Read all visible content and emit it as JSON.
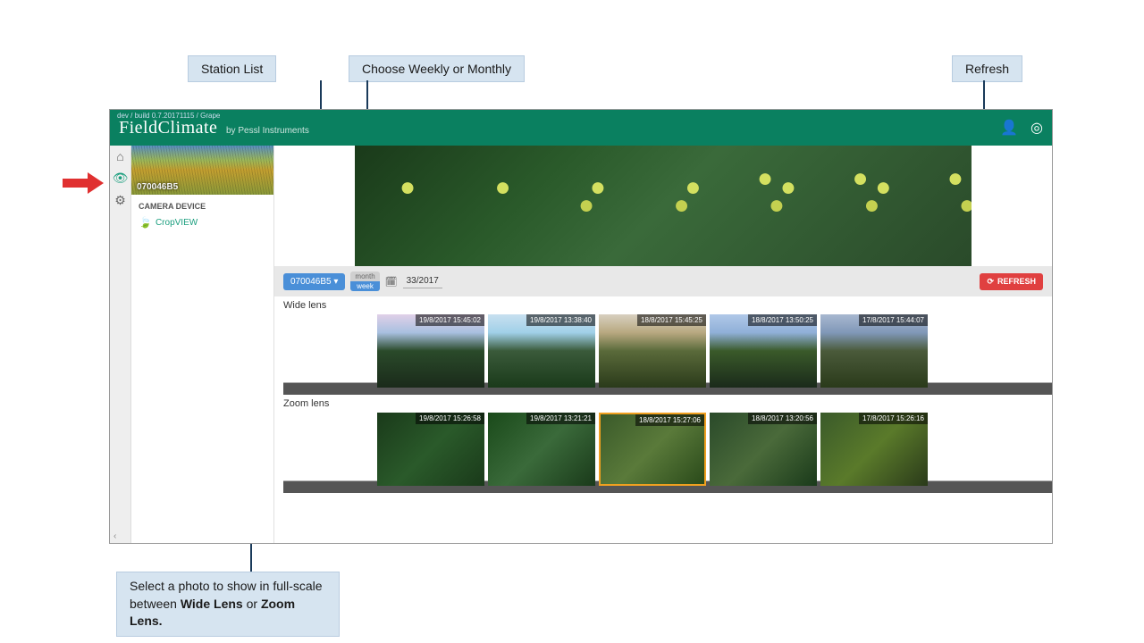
{
  "callouts": {
    "station_list": "Station List",
    "choose_period": "Choose Weekly or Monthly",
    "refresh": "Refresh",
    "select_photo_prefix": "Select a photo to show in full-scale between ",
    "wide_lens_bold": "Wide Lens",
    "or_text": " or ",
    "zoom_lens_bold": "Zoom Lens."
  },
  "header": {
    "breadcrumb": "dev / build 0.7.20171115 / Grape",
    "logo_main": "FieldClimate",
    "logo_sub": "by Pessl Instruments"
  },
  "sidebar": {
    "station_id": "070046B5",
    "device_title": "CAMERA DEVICE",
    "device_name": "CropVIEW"
  },
  "controls": {
    "station_dd": "070046B5 ▾",
    "month": "month",
    "week": "week",
    "date": "33/2017",
    "refresh": "REFRESH"
  },
  "sections": {
    "wide": {
      "title": "Wide lens",
      "thumbs": [
        {
          "ts": "19/8/2017 15:45:02"
        },
        {
          "ts": "19/8/2017 13:38:40"
        },
        {
          "ts": "18/8/2017 15:45:25"
        },
        {
          "ts": "18/8/2017 13:50:25"
        },
        {
          "ts": "17/8/2017 15:44:07"
        }
      ]
    },
    "zoom": {
      "title": "Zoom lens",
      "thumbs": [
        {
          "ts": "19/8/2017 15:26:58"
        },
        {
          "ts": "19/8/2017 13:21:21"
        },
        {
          "ts": "18/8/2017 15:27:06"
        },
        {
          "ts": "18/8/2017 13:20:56"
        },
        {
          "ts": "17/8/2017 15:26:16"
        }
      ]
    }
  }
}
